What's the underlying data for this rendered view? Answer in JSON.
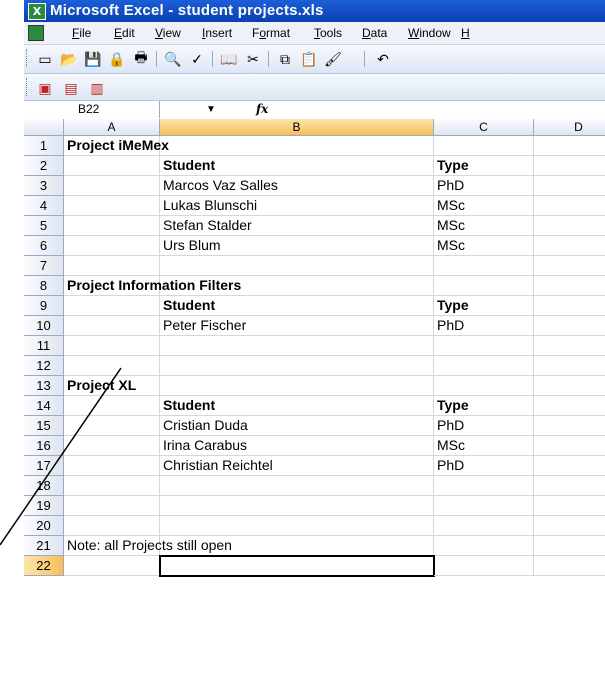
{
  "window": {
    "title": "Microsoft Excel - student projects.xls",
    "app_icon": "excel-icon"
  },
  "menu": {
    "items": [
      {
        "mnemonic": "F",
        "rest": "ile"
      },
      {
        "mnemonic": "E",
        "rest": "dit"
      },
      {
        "mnemonic": "V",
        "rest": "iew"
      },
      {
        "mnemonic": "I",
        "rest": "nsert"
      },
      {
        "pre": "F",
        "mnemonic": "o",
        "rest": "rmat"
      },
      {
        "mnemonic": "T",
        "rest": "ools"
      },
      {
        "mnemonic": "D",
        "rest": "ata"
      },
      {
        "mnemonic": "W",
        "rest": "indow"
      },
      {
        "mnemonic": "H",
        "rest": ""
      }
    ]
  },
  "toolbar": {
    "icons": [
      "new-icon",
      "open-icon",
      "save-icon",
      "permission-icon",
      "print-icon",
      "print-preview-icon",
      "spelling-icon",
      "research-icon",
      "cut-icon",
      "copy-icon",
      "paste-icon",
      "format-painter-icon",
      "undo-icon"
    ]
  },
  "pdf_toolbar": {
    "icons": [
      "pdf-convert-icon",
      "pdf-email-icon",
      "pdf-review-icon"
    ]
  },
  "formula_bar": {
    "name_box": "B22",
    "fx": "fx",
    "formula": ""
  },
  "columns": [
    "A",
    "B",
    "C",
    "D"
  ],
  "rows": [
    {
      "n": "1",
      "a": "Project iMeMex",
      "b": "",
      "c": "",
      "bold_a": true
    },
    {
      "n": "2",
      "a": "",
      "b": "Student",
      "c": "Type",
      "bold_b": true,
      "bold_c": true
    },
    {
      "n": "3",
      "a": "",
      "b": "Marcos Vaz Salles",
      "c": "PhD"
    },
    {
      "n": "4",
      "a": "",
      "b": "Lukas Blunschi",
      "c": "MSc"
    },
    {
      "n": "5",
      "a": "",
      "b": "Stefan Stalder",
      "c": "MSc"
    },
    {
      "n": "6",
      "a": "",
      "b": "Urs Blum",
      "c": "MSc"
    },
    {
      "n": "7",
      "a": "",
      "b": "",
      "c": ""
    },
    {
      "n": "8",
      "a": "Project Information Filters",
      "b": "",
      "c": "",
      "bold_a": true
    },
    {
      "n": "9",
      "a": "",
      "b": "Student",
      "c": "Type",
      "bold_b": true,
      "bold_c": true
    },
    {
      "n": "10",
      "a": "",
      "b": "Peter Fischer",
      "c": "PhD"
    },
    {
      "n": "11",
      "a": "",
      "b": "",
      "c": ""
    },
    {
      "n": "12",
      "a": "",
      "b": "",
      "c": ""
    },
    {
      "n": "13",
      "a": "Project XL",
      "b": "",
      "c": "",
      "bold_a": true
    },
    {
      "n": "14",
      "a": "",
      "b": "Student",
      "c": "Type",
      "bold_b": true,
      "bold_c": true
    },
    {
      "n": "15",
      "a": "",
      "b": "Cristian Duda",
      "c": "PhD"
    },
    {
      "n": "16",
      "a": "",
      "b": "Irina Carabus",
      "c": "MSc"
    },
    {
      "n": "17",
      "a": "",
      "b": "Christian Reichtel",
      "c": "PhD"
    },
    {
      "n": "18",
      "a": "",
      "b": "",
      "c": ""
    },
    {
      "n": "19",
      "a": "",
      "b": "",
      "c": ""
    },
    {
      "n": "20",
      "a": "",
      "b": "",
      "c": ""
    },
    {
      "n": "21",
      "a": "Note: all Projects still open",
      "b": "",
      "c": ""
    },
    {
      "n": "22",
      "a": "",
      "b": "",
      "c": "",
      "active": true
    }
  ],
  "selection": {
    "column": "B",
    "row": "22"
  }
}
